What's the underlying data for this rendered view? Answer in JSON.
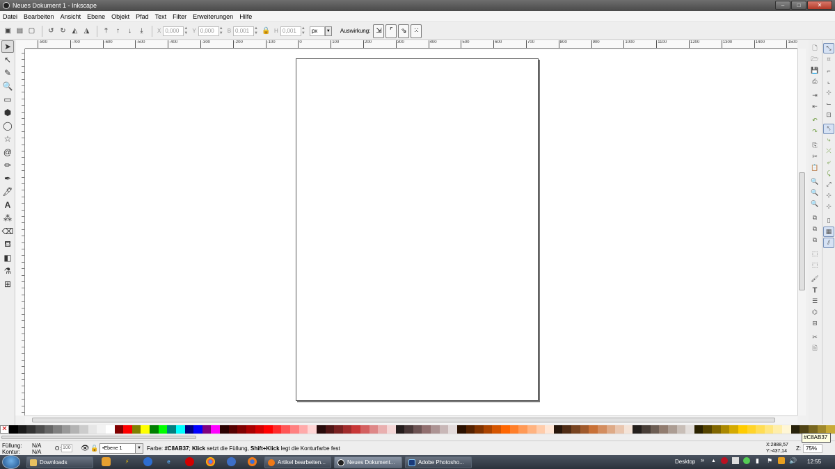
{
  "window": {
    "title": "Neues Dokument 1 - Inkscape",
    "minimize": "‒",
    "maximize": "□",
    "close": "✕"
  },
  "menu": [
    "Datei",
    "Bearbeiten",
    "Ansicht",
    "Ebene",
    "Objekt",
    "Pfad",
    "Text",
    "Filter",
    "Erweiterungen",
    "Hilfe"
  ],
  "controls": {
    "x_label": "X",
    "x_value": "0,000",
    "y_label": "Y",
    "y_value": "0,000",
    "w_label": "B",
    "w_value": "0,001",
    "h_label": "H",
    "h_value": "0,001",
    "unit": "px",
    "affect_label": "Auswirkung:"
  },
  "rulers": {
    "h_labels": [
      "-800",
      "-700",
      "-600",
      "-500",
      "-400",
      "-300",
      "-200",
      "-100",
      "0",
      "100",
      "200",
      "300",
      "400",
      "500",
      "600",
      "700",
      "800",
      "900",
      "1000",
      "1100",
      "1200",
      "1300",
      "1400",
      "1500"
    ]
  },
  "palette": {
    "colors": [
      "#000000",
      "#1a1a1a",
      "#333333",
      "#4d4d4d",
      "#666666",
      "#808080",
      "#999999",
      "#b3b3b3",
      "#cccccc",
      "#e6e6e6",
      "#f2f2f2",
      "#ffffff",
      "#800000",
      "#ff0000",
      "#808000",
      "#ffff00",
      "#008000",
      "#00ff00",
      "#008080",
      "#00ffff",
      "#000080",
      "#0000ff",
      "#800080",
      "#ff00ff",
      "#2b0000",
      "#550000",
      "#800000",
      "#aa0000",
      "#d40000",
      "#ff0000",
      "#ff2a2a",
      "#ff5555",
      "#ff8080",
      "#ffaaaa",
      "#ffd5d5",
      "#280b0b",
      "#501616",
      "#782121",
      "#a02c2c",
      "#c83737",
      "#d35f5f",
      "#de8787",
      "#e9afaf",
      "#f4d7d7",
      "#241c1c",
      "#483737",
      "#6c5353",
      "#916f6f",
      "#ac9393",
      "#c8b7b7",
      "#e3dbdb",
      "#2b1100",
      "#552200",
      "#803300",
      "#aa4400",
      "#d45500",
      "#ff6600",
      "#ff7f2a",
      "#ff9955",
      "#ffb380",
      "#ffccaa",
      "#ffe6d5",
      "#28170b",
      "#502d16",
      "#784421",
      "#a05a2c",
      "#c87137",
      "#d38d5f",
      "#deaa87",
      "#e9c6af",
      "#f4e3d7",
      "#241f1c",
      "#483e37",
      "#6c5d53",
      "#917c6f",
      "#ac9d93",
      "#c8beb7",
      "#e3dedb",
      "#2b2200",
      "#554400",
      "#806600",
      "#aa8800",
      "#d4aa00",
      "#ffcc00",
      "#ffd42a",
      "#ffdd55",
      "#ffe680",
      "#ffeeaa",
      "#fff6d5",
      "#28220b",
      "#504416",
      "#786721",
      "#a0892c",
      "#c8ab37"
    ],
    "tooltip": "#C8AB37"
  },
  "status": {
    "fill_label": "Füllung:",
    "fill_value": "N/A",
    "stroke_label": "Kontur:",
    "stroke_value": "N/A",
    "opacity_label": "O:",
    "opacity_value": "100",
    "layer": "•Ebene 1",
    "message_prefix": "Farbe: ",
    "message_color": "#C8AB37",
    "message_sep": "; ",
    "message_click": "Klick",
    "message_mid": " setzt die Füllung, ",
    "message_shift": "Shift+Klick",
    "message_end": " legt die Konturfarbe fest",
    "x_coord": "X:2888,57",
    "y_coord": "Y:-437,14",
    "zoom_label": "Z:",
    "zoom_value": "75%"
  },
  "taskbar": {
    "items": [
      {
        "label": "Downloads",
        "active": false
      },
      {
        "label": "Artikel bearbeiten...",
        "active": false
      },
      {
        "label": "Neues Dokument...",
        "active": true
      },
      {
        "label": "Adobe Photosho...",
        "active": false
      }
    ],
    "desktop": "Desktop",
    "time": "12:55"
  }
}
